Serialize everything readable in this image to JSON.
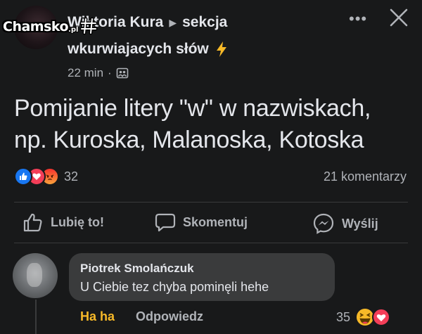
{
  "watermark": {
    "brand": "Chamsko",
    "suffix": ".pl"
  },
  "post": {
    "author": "Wiktoria Kura",
    "group_part1": "sekcja",
    "group_part2": "wkurwiajacych słów",
    "time": "22 min",
    "separator": "·",
    "text_line1": "Pomijanie litery \"w\" w nazwiskach,",
    "text_line2": "np. Kuroska, Malanoska, Kotoska",
    "reaction_count": "32",
    "comments_count": "21 komentarzy"
  },
  "actions": {
    "like": "Lubię to!",
    "comment": "Skomentuj",
    "send": "Wyślij"
  },
  "comment": {
    "author": "Piotrek Smolańczuk",
    "text": "U Ciebie tez chyba pominęli hehe",
    "reaction_label": "Ha ha",
    "reply_label": "Odpowiedz",
    "reaction_count": "35"
  },
  "colors": {
    "background": "#18191a",
    "bubble": "#3a3b3c",
    "like_blue": "#1877f2",
    "love_red": "#f33e58",
    "haha_yellow": "#f7b928",
    "secondary_text": "#b0b3b8"
  },
  "icons": [
    "more-icon",
    "close-icon",
    "group-privacy-icon",
    "lightning-icon",
    "like-reaction-icon",
    "love-reaction-icon",
    "angry-reaction-icon",
    "thumbs-up-icon",
    "comment-icon",
    "messenger-icon",
    "haha-reaction-icon"
  ]
}
